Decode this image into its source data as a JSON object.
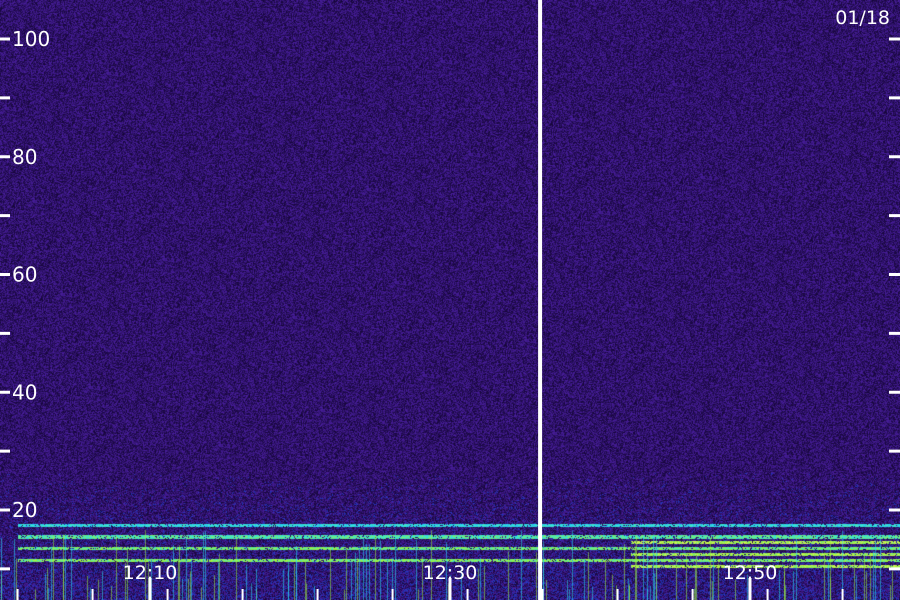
{
  "date_label": "01/18",
  "colors": {
    "background": "#2a0d64",
    "noise_dark": "#140536",
    "noise_light": "#4a1fa0",
    "band_blue": "#1b49e6",
    "band_cyan": "#29e0f0",
    "band_green": "#9cf53a",
    "band_yellow": "#f2f266",
    "marker": "#ffffff",
    "text": "#ffffff"
  },
  "chart_data": {
    "type": "heatmap",
    "title": "",
    "xlabel": "",
    "ylabel": "",
    "ylim": [
      10,
      105
    ],
    "y_labeled_ticks": [
      20,
      40,
      60,
      80,
      100
    ],
    "y_minor_ticks": [
      10,
      30,
      50,
      70,
      90
    ],
    "xlim_minutes": [
      12.02,
      13.06
    ],
    "x_tick_labels": [
      "12:10",
      "12:30",
      "12:50"
    ],
    "x_tick_positions": [
      12.167,
      12.5,
      12.833
    ],
    "vertical_marker_at": 12.6,
    "bands": [
      {
        "y": 17.5,
        "x_from": 12.02,
        "x_to": 13.06,
        "intensity": 0.45
      },
      {
        "y": 15.5,
        "x_from": 12.02,
        "x_to": 13.06,
        "intensity": 0.6
      },
      {
        "y": 14.5,
        "x_from": 12.7,
        "x_to": 13.06,
        "intensity": 0.95
      },
      {
        "y": 13.5,
        "x_from": 12.02,
        "x_to": 13.06,
        "intensity": 0.7
      },
      {
        "y": 12.5,
        "x_from": 12.7,
        "x_to": 13.06,
        "intensity": 0.9
      },
      {
        "y": 11.5,
        "x_from": 12.02,
        "x_to": 13.06,
        "intensity": 0.75
      },
      {
        "y": 10.5,
        "x_from": 12.7,
        "x_to": 13.06,
        "intensity": 0.95
      }
    ]
  }
}
